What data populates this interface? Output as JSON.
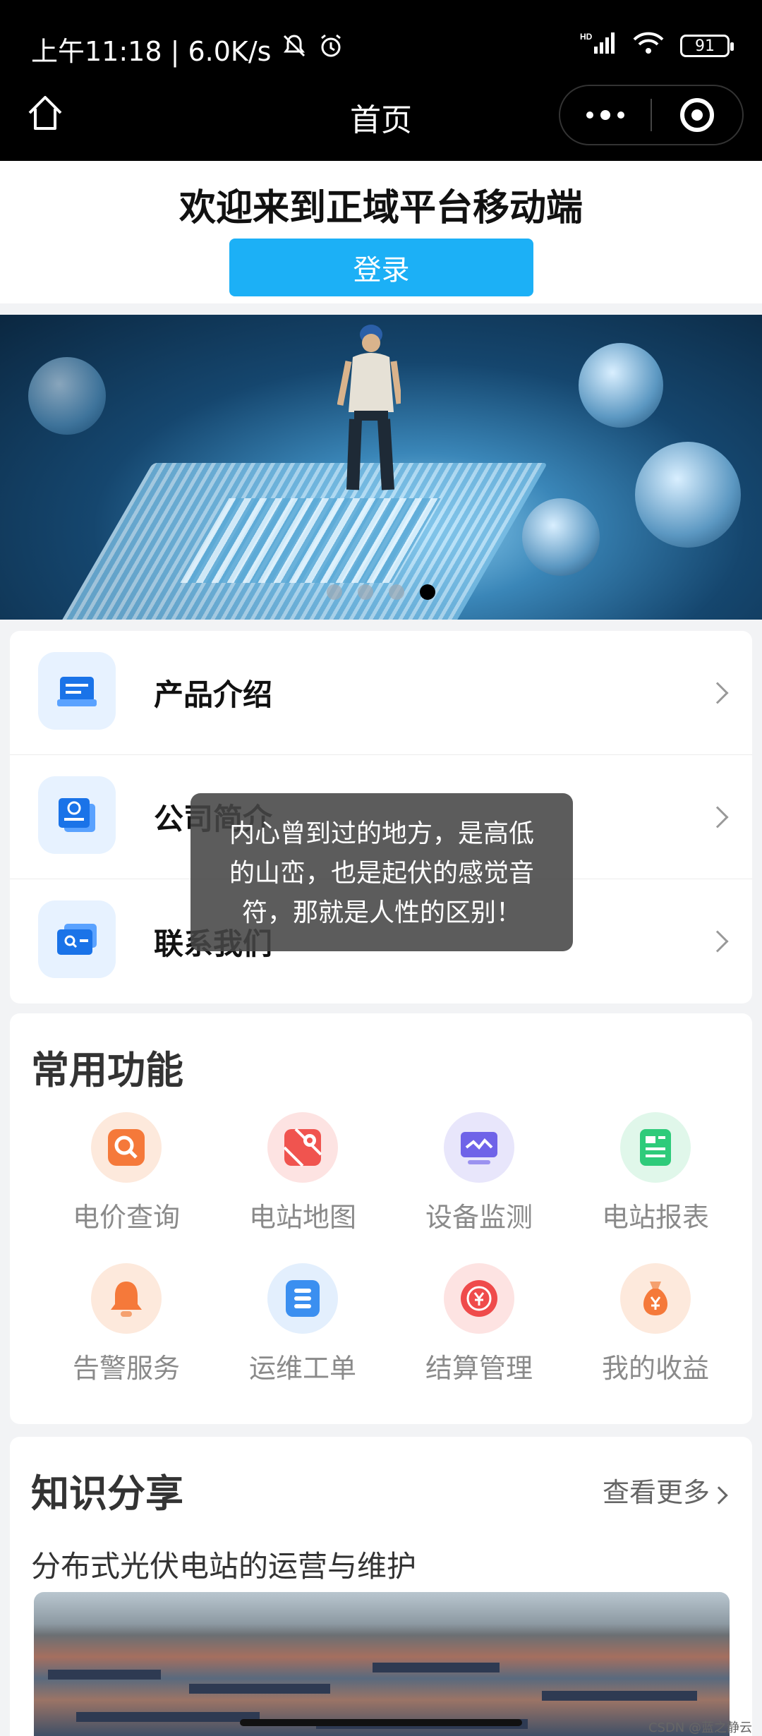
{
  "status_bar": {
    "time_speed": "上午11:18 | 6.0K/s",
    "network": "HD",
    "battery": "91"
  },
  "nav": {
    "title": "首页"
  },
  "welcome": {
    "heading": "欢迎来到正域平台移动端",
    "login_label": "登录"
  },
  "banner": {
    "slide_count": 4,
    "active_index": 3
  },
  "menu": [
    {
      "label": "产品介绍",
      "icon": "product-icon"
    },
    {
      "label": "公司简介",
      "icon": "company-icon"
    },
    {
      "label": "联系我们",
      "icon": "contact-icon"
    }
  ],
  "toast": {
    "message": "内心曾到过的地方，是高低的山峦，也是起伏的感觉音符，那就是人性的区别！"
  },
  "functions": {
    "title": "常用功能",
    "items": [
      {
        "label": "电价查询",
        "icon": "search-icon",
        "color": "#f5793a"
      },
      {
        "label": "电站地图",
        "icon": "map-pin-icon",
        "color": "#f0544f"
      },
      {
        "label": "设备监测",
        "icon": "monitor-icon",
        "color": "#6f63e8"
      },
      {
        "label": "电站报表",
        "icon": "report-icon",
        "color": "#2ecb7a"
      },
      {
        "label": "告警服务",
        "icon": "bell-icon",
        "color": "#f5793a"
      },
      {
        "label": "运维工单",
        "icon": "list-icon",
        "color": "#3b8ff0"
      },
      {
        "label": "结算管理",
        "icon": "yuan-cycle-icon",
        "color": "#ef4b4b"
      },
      {
        "label": "我的收益",
        "icon": "money-bag-icon",
        "color": "#f5793a"
      }
    ]
  },
  "knowledge": {
    "title": "知识分享",
    "more_label": "查看更多",
    "article_title": "分布式光伏电站的运营与维护"
  },
  "watermark": "CSDN @蓝之静云"
}
